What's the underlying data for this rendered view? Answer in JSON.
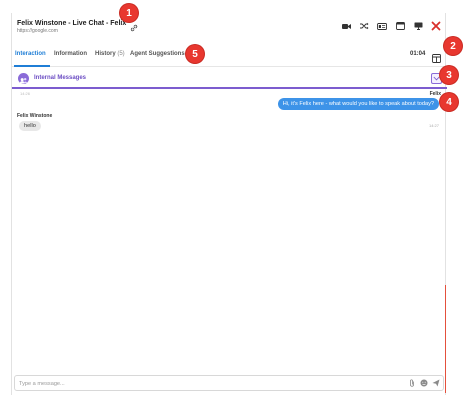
{
  "header": {
    "title": "Felix Winstone - Live Chat - Felix",
    "url": "https://google.com",
    "icons": [
      "video-icon",
      "transfer-icon",
      "id-card-icon",
      "window-icon",
      "monitor-icon",
      "close-icon"
    ]
  },
  "tabs": [
    {
      "label": "Interaction",
      "count": ""
    },
    {
      "label": "Information",
      "count": ""
    },
    {
      "label": "History",
      "count": "(5)"
    },
    {
      "label": "Agent Suggestions",
      "count": ""
    }
  ],
  "timer": "01:04",
  "internal": {
    "label": "Internal Messages"
  },
  "messages": {
    "agent_timestamp": "14:26",
    "agent_name": "Felix",
    "agent_text": "Hi, it's Felix here - what would you like to speak about today?",
    "visitor_name": "Felix Winstone",
    "visitor_text": "hello",
    "visitor_timestamp": "14:27"
  },
  "composer": {
    "placeholder": "Type a message..."
  },
  "callouts": [
    "1",
    "2",
    "3",
    "4",
    "5"
  ],
  "colors": {
    "accent_blue": "#1f7ed6",
    "internal_purple": "#7c5ccf",
    "agent_bubble": "#3d93e8",
    "close_red": "#d9302b",
    "callout_red": "#e8372f"
  }
}
